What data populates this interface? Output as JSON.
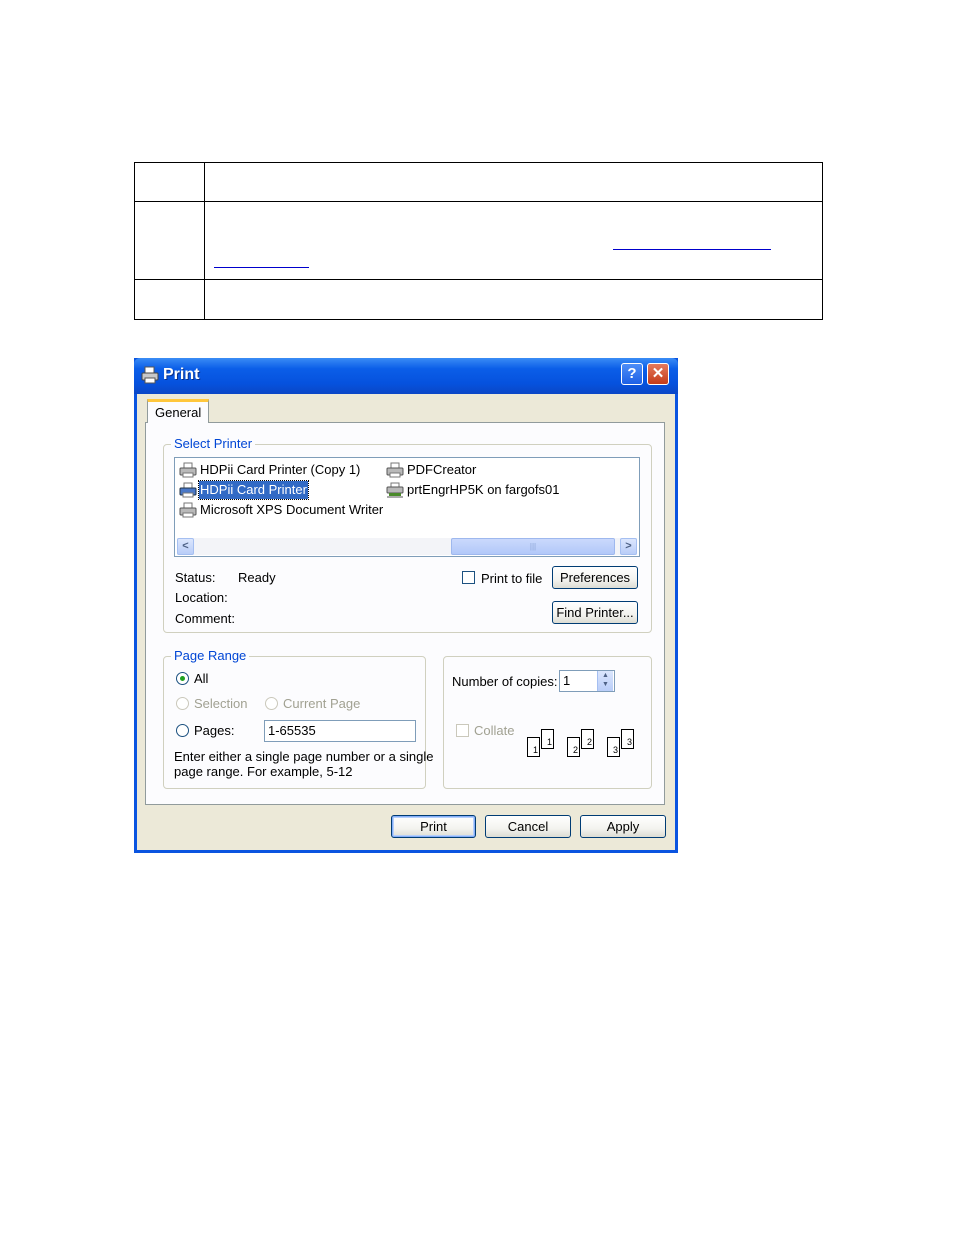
{
  "dialog": {
    "title": "Print",
    "help_glyph": "?",
    "close_glyph": "✕",
    "tab_general": "General",
    "select_printer": {
      "label": "Select Printer",
      "printers": [
        {
          "name": "HDPii Card Printer (Copy 1)",
          "icon": "printer-icon",
          "selected": false
        },
        {
          "name": "HDPii Card Printer",
          "icon": "printer-icon",
          "selected": true
        },
        {
          "name": "Microsoft XPS Document Writer",
          "icon": "printer-icon",
          "selected": false
        },
        {
          "name": "PDFCreator",
          "icon": "printer-icon",
          "selected": false
        },
        {
          "name": "prtEngrHP5K on fargofs01",
          "icon": "network-printer-icon",
          "selected": false
        }
      ],
      "scroll_left": "<",
      "scroll_right": ">",
      "status_label": "Status:",
      "status_value": "Ready",
      "location_label": "Location:",
      "comment_label": "Comment:",
      "print_to_file": "Print to file",
      "preferences_button": "Preferences",
      "find_printer_button": "Find Printer..."
    },
    "page_range": {
      "label": "Page Range",
      "all": "All",
      "selection": "Selection",
      "current_page": "Current Page",
      "pages": "Pages:",
      "pages_value": "1-65535",
      "hint_line1": "Enter either a single page number or a single",
      "hint_line2": "page range.  For example, 5-12"
    },
    "copies": {
      "label": "Number of copies:",
      "value": "1",
      "collate": "Collate",
      "collate_pages": [
        "1",
        "1",
        "2",
        "2",
        "3",
        "3"
      ]
    },
    "buttons": {
      "print": "Print",
      "cancel": "Cancel",
      "apply": "Apply"
    },
    "colors": {
      "title_bar": "#0a54e0",
      "selection": "#316ac5",
      "group_label": "#0046d5"
    }
  }
}
